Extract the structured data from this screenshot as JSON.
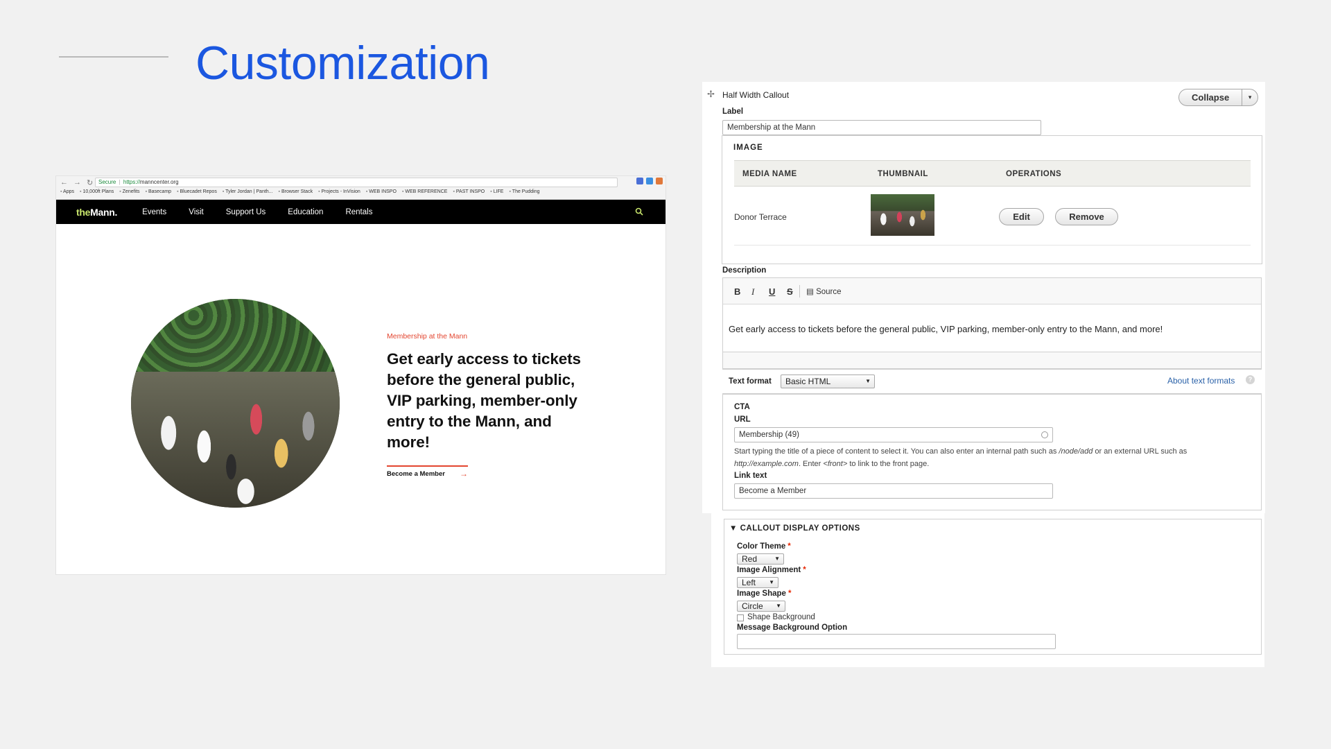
{
  "slide": {
    "title": "Customization"
  },
  "browser": {
    "nav_icons": [
      "←",
      "→",
      "↻"
    ],
    "secure_label": "Secure",
    "url_prefix": "https://",
    "url_host": "manncenter.org",
    "bookmarks": [
      "Apps",
      "10,000ft Plans",
      "Zenefits",
      "Basecamp",
      "Bluecadet Repos",
      "Tyler Jordan | Panth...",
      "Browser Stack",
      "Projects - InVision",
      "WEB INSPO",
      "WEB REFERENCE",
      "PAST INSPO",
      "LIFE",
      "The Pudding"
    ]
  },
  "site": {
    "logo_the": "the",
    "logo_mann": "Mann.",
    "nav": [
      "Events",
      "Visit",
      "Support Us",
      "Education",
      "Rentals"
    ],
    "search_icon": "search-icon",
    "eyebrow": "Membership at the Mann",
    "headline": "Get early access to tickets before the general public, VIP parking, member-only entry to the Mann, and more!",
    "cta": "Become a Member",
    "cta_arrow": "→",
    "accent_color": "#e3452f"
  },
  "form": {
    "paragraph_title": "Half Width Callout",
    "collapse_label": "Collapse",
    "caret": "▾",
    "label_label": "Label",
    "label_value": "Membership at the Mann",
    "image_legend": "IMAGE",
    "table_headers": [
      "MEDIA NAME",
      "THUMBNAIL",
      "OPERATIONS"
    ],
    "media_name": "Donor Terrace",
    "edit_label": "Edit",
    "remove_label": "Remove",
    "description_label": "Description",
    "toolbar": {
      "bold": "B",
      "italic": "I",
      "underline": "U",
      "strike": "S",
      "source": "Source"
    },
    "description_text": "Get early access to tickets before the general public, VIP parking, member-only entry to the Mann, and more!",
    "text_format_label": "Text format",
    "text_format_value": "Basic HTML",
    "about_formats": "About text formats",
    "help_glyph": "?",
    "cta_legend": "CTA",
    "url_label": "URL",
    "url_value": "Membership (49)",
    "help_1": "Start typing the title of a piece of content to select it. You can also enter an internal path such as ",
    "help_path": "/node/add",
    "help_2": " or an external URL such as ",
    "help_example": "http://example.com",
    "help_3": ". Enter ",
    "help_front": "<front>",
    "help_4": " to link to the front page.",
    "link_text_label": "Link text",
    "link_text_value": "Become a Member",
    "options_legend": "CALLOUT DISPLAY OPTIONS",
    "options_toggle": "▼",
    "color_theme_label": "Color Theme",
    "color_theme_value": "Red",
    "image_alignment_label": "Image Alignment",
    "image_alignment_value": "Left",
    "image_shape_label": "Image Shape",
    "image_shape_value": "Circle",
    "required_mark": "*",
    "shape_background_label": "Shape Background",
    "message_bg_label": "Message Background Option",
    "message_bg_value": ""
  }
}
